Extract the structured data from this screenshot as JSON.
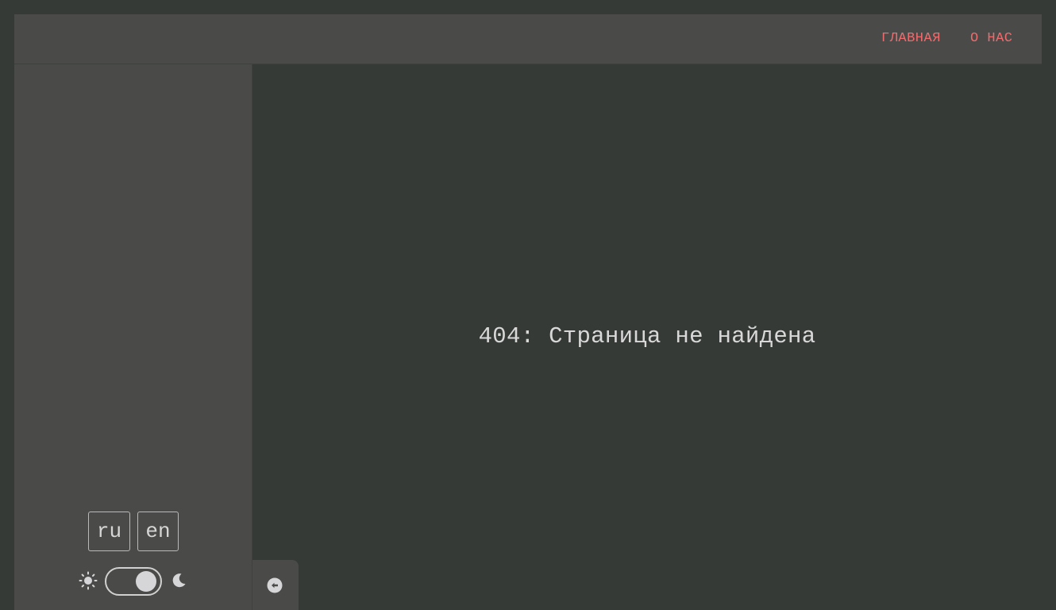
{
  "header": {
    "nav": [
      {
        "label": "ГЛАВНАЯ"
      },
      {
        "label": "О НАС"
      }
    ],
    "link_color": "#ee6b6e"
  },
  "sidebar": {
    "languages": [
      "ru",
      "en"
    ],
    "theme_toggle": {
      "state": "dark",
      "left_icon": "sun-icon",
      "right_icon": "moon-icon"
    },
    "collapse_icon": "arrow-left-circle-icon"
  },
  "main": {
    "message": "404: Страница не найдена"
  },
  "colors": {
    "background": "#363a37",
    "panel": "#4a4b48",
    "text": "#d8d8d8"
  }
}
